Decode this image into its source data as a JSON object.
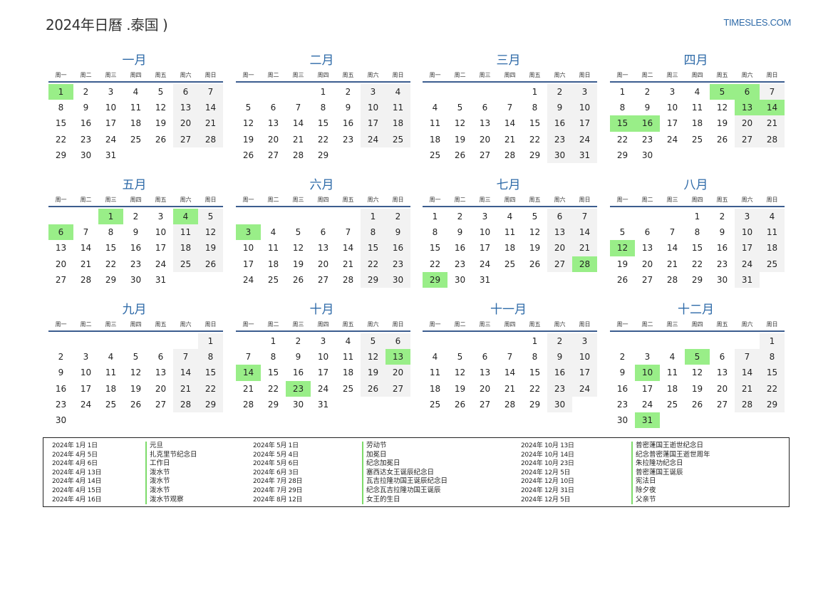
{
  "header": {
    "title": "2024年日曆 .泰国 )",
    "site": "TIMESLES.COM"
  },
  "weekdays": [
    "周一",
    "周二",
    "周三",
    "周四",
    "周五",
    "周六",
    "周日"
  ],
  "months": [
    {
      "name": "一月",
      "offset": 0,
      "days": 31,
      "holidays": [
        1
      ]
    },
    {
      "name": "二月",
      "offset": 3,
      "days": 29,
      "holidays": []
    },
    {
      "name": "三月",
      "offset": 4,
      "days": 31,
      "holidays": []
    },
    {
      "name": "四月",
      "offset": 0,
      "days": 30,
      "holidays": [
        5,
        6,
        13,
        14,
        15,
        16
      ]
    },
    {
      "name": "五月",
      "offset": 2,
      "days": 31,
      "holidays": [
        1,
        4,
        6
      ]
    },
    {
      "name": "六月",
      "offset": 5,
      "days": 30,
      "holidays": [
        3
      ]
    },
    {
      "name": "七月",
      "offset": 0,
      "days": 31,
      "holidays": [
        28,
        29
      ]
    },
    {
      "name": "八月",
      "offset": 3,
      "days": 31,
      "holidays": [
        12
      ]
    },
    {
      "name": "九月",
      "offset": 6,
      "days": 30,
      "holidays": []
    },
    {
      "name": "十月",
      "offset": 1,
      "days": 31,
      "holidays": [
        13,
        14,
        23
      ]
    },
    {
      "name": "十一月",
      "offset": 4,
      "days": 30,
      "holidays": []
    },
    {
      "name": "十二月",
      "offset": 6,
      "days": 31,
      "holidays": [
        5,
        10,
        31
      ]
    }
  ],
  "holiday_list": [
    {
      "date": "2024年 1月 1日",
      "name": "元旦"
    },
    {
      "date": "2024年 4月 5日",
      "name": "扎克里节纪念日"
    },
    {
      "date": "2024年 4月 6日",
      "name": "工作日"
    },
    {
      "date": "2024年 4月 13日",
      "name": "泼水节"
    },
    {
      "date": "2024年 4月 14日",
      "name": "泼水节"
    },
    {
      "date": "2024年 4月 15日",
      "name": "泼水节"
    },
    {
      "date": "2024年 4月 16日",
      "name": "泼水节观察"
    },
    {
      "date": "2024年 5月 1日",
      "name": "劳动节"
    },
    {
      "date": "2024年 5月 4日",
      "name": "加冕日"
    },
    {
      "date": "2024年 5月 6日",
      "name": "纪念加冕日"
    },
    {
      "date": "2024年 6月 3日",
      "name": "塞西达女王诞辰纪念日"
    },
    {
      "date": "2024年 7月 28日",
      "name": "瓦吉拉隆功国王诞辰纪念日"
    },
    {
      "date": "2024年 7月 29日",
      "name": "纪念瓦吉拉隆功国王诞辰"
    },
    {
      "date": "2024年 8月 12日",
      "name": "女王的生日"
    },
    {
      "date": "2024年 10月 13日",
      "name": "普密蓬国王逝世纪念日"
    },
    {
      "date": "2024年 10月 14日",
      "name": "纪念普密蓬国王逝世周年"
    },
    {
      "date": "2024年 10月 23日",
      "name": "朱拉隆功纪念日"
    },
    {
      "date": "2024年 12月 5日",
      "name": "普密蓬国王诞辰"
    },
    {
      "date": "2024年 12月 10日",
      "name": "宪法日"
    },
    {
      "date": "2024年 12月 31日",
      "name": "除夕夜"
    },
    {
      "date": "2024年 12月 5日",
      "name": "父亲节"
    }
  ]
}
